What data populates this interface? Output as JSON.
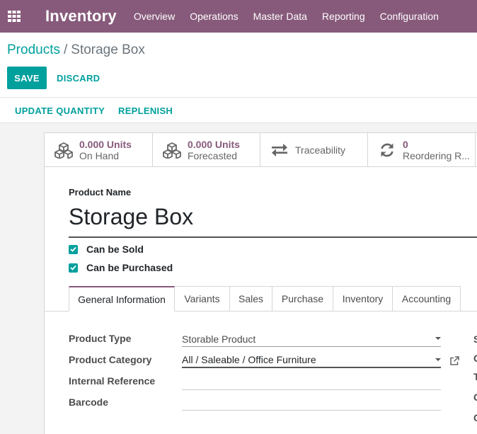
{
  "app": {
    "title": "Inventory",
    "menu": [
      "Overview",
      "Operations",
      "Master Data",
      "Reporting",
      "Configuration"
    ],
    "navbar_color": "#875a7b"
  },
  "breadcrumb": {
    "parent": "Products",
    "separator": "/",
    "current": "Storage Box"
  },
  "actions": {
    "save": "SAVE",
    "discard": "DISCARD"
  },
  "header_buttons": {
    "update_quantity": "UPDATE QUANTITY",
    "replenish": "REPLENISH"
  },
  "smart_buttons": {
    "on_hand": {
      "value": "0.000 Units",
      "label": "On Hand",
      "icon": "cubes-icon"
    },
    "forecasted": {
      "value": "0.000 Units",
      "label": "Forecasted",
      "icon": "cubes-icon"
    },
    "traceability": {
      "label": "Traceability",
      "icon": "exchange-arrows-icon"
    },
    "reordering": {
      "value": "0",
      "label": "Reordering R...",
      "icon": "refresh-icon"
    }
  },
  "product": {
    "name_label": "Product Name",
    "name": "Storage Box",
    "can_be_sold": {
      "label": "Can be Sold",
      "checked": true
    },
    "can_be_purchased": {
      "label": "Can be Purchased",
      "checked": true
    }
  },
  "tabs": [
    "General Information",
    "Variants",
    "Sales",
    "Purchase",
    "Inventory",
    "Accounting"
  ],
  "active_tab": "General Information",
  "fields": {
    "product_type": {
      "label": "Product Type",
      "value": "Storable Product"
    },
    "product_category": {
      "label": "Product Category",
      "value": "All / Saleable / Office Furniture"
    },
    "internal_reference": {
      "label": "Internal Reference",
      "value": ""
    },
    "barcode": {
      "label": "Barcode",
      "value": ""
    }
  },
  "right_column_letters": [
    "S",
    "C",
    "T",
    "C",
    "C"
  ],
  "accent_color": "#00a09d"
}
